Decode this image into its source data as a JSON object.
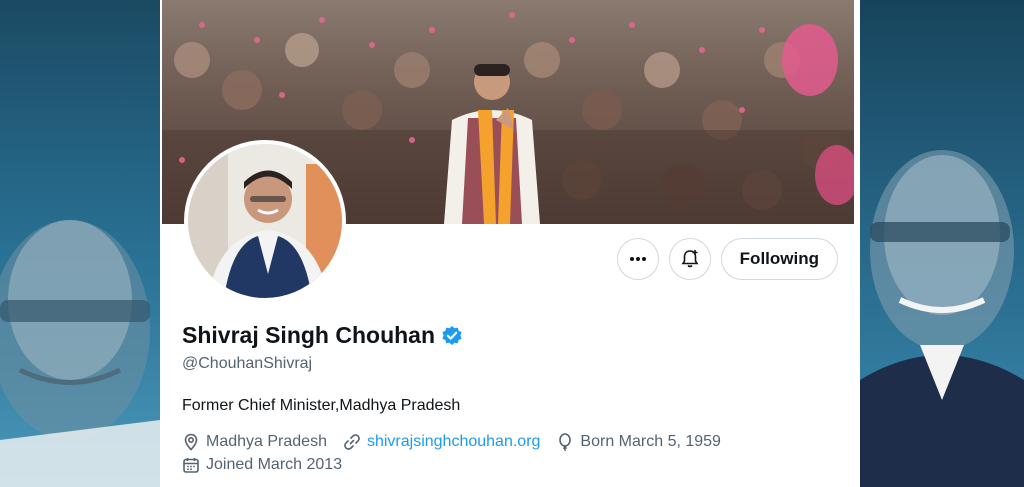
{
  "profile": {
    "name": "Shivraj Singh Chouhan",
    "handle": "@ChouhanShivraj",
    "bio": "Former Chief Minister,Madhya Pradesh",
    "location": "Madhya Pradesh",
    "website": "shivrajsinghchouhan.org",
    "born": "Born March 5, 1959",
    "joined": "Joined March 2013",
    "verified": true
  },
  "actions": {
    "more_icon": "more-horizontal-icon",
    "notify_icon": "bell-plus-icon",
    "follow_label": "Following"
  },
  "colors": {
    "verified_badge": "#1d9bf0",
    "link": "#1d9bf0",
    "muted_text": "#536471",
    "primary_text": "#0f1419",
    "background": "#1f6c8f"
  }
}
